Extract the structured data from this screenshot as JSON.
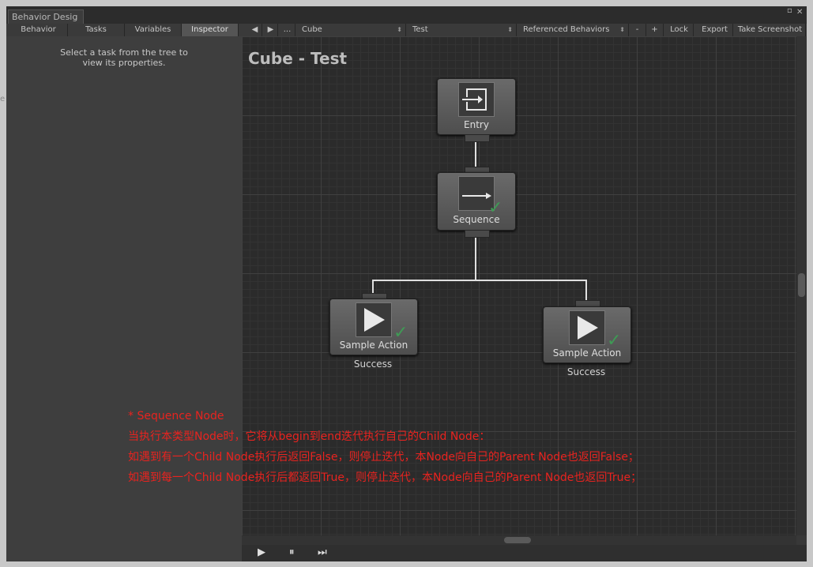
{
  "window": {
    "title": "Behavior Desig",
    "buttons": [
      "▫",
      "✕"
    ]
  },
  "toolbar": {
    "tabs": [
      "Behavior",
      "Tasks",
      "Variables",
      "Inspector"
    ],
    "active_tab": "Inspector",
    "nav_prev": "◀",
    "nav_next": "▶",
    "more": "...",
    "object_select": "Cube",
    "behavior_select": "Test",
    "referenced_select": "Referenced Behaviors",
    "remove": "-",
    "add": "+",
    "lock": "Lock",
    "export": "Export",
    "screenshot": "Take Screenshot"
  },
  "inspector": {
    "message_line1": "Select a task from the tree to",
    "message_line2": "view its properties."
  },
  "graph": {
    "title": "Cube - Test",
    "nodes": {
      "entry": {
        "label": "Entry"
      },
      "sequence": {
        "label": "Sequence"
      },
      "action1": {
        "label": "Sample Action",
        "status": "Success"
      },
      "action2": {
        "label": "Sample Action",
        "status": "Success"
      }
    }
  },
  "annotation": {
    "line1": "* Sequence Node",
    "line2": "当执行本类型Node时，它将从begin到end迭代执行自己的Child Node：",
    "line3": "如遇到有一个Child Node执行后返回False，则停止迭代，本Node向自己的Parent Node也返回False；",
    "line4": "如遇到每一个Child Node执行后都返回True，则停止迭代，本Node向自己的Parent Node也返回True；"
  },
  "playback": {
    "play": "▶",
    "pause": "⏸",
    "step": "⏭"
  },
  "colors": {
    "annotation": "#e8231f",
    "success_check": "#3f9a55",
    "graph_bg": "#2b2b2b"
  }
}
